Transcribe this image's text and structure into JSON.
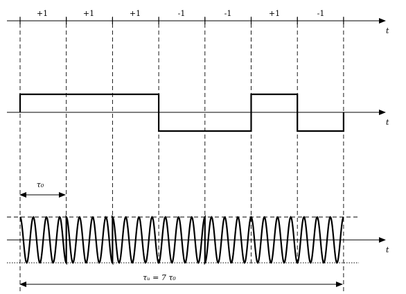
{
  "diagram": {
    "chip_labels": [
      "+1",
      "+1",
      "+1",
      "-1",
      "-1",
      "+1",
      "-1"
    ],
    "time_axis_label": "t",
    "chip_duration_label": "τ₀",
    "total_duration_label": "τᵤ = 7 τ₀",
    "chip_sequence": [
      1,
      1,
      1,
      -1,
      -1,
      1,
      -1
    ],
    "cycles_per_chip": 3.5
  }
}
